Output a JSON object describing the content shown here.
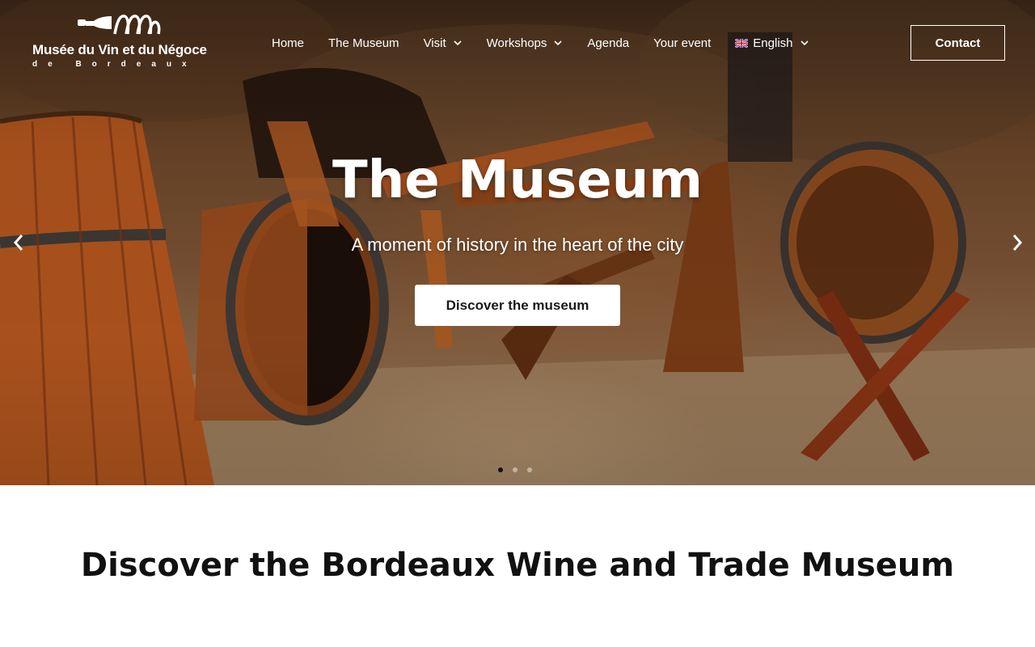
{
  "logo": {
    "line1": "Musée du Vin et du Négoce",
    "line2": "de Bordeaux"
  },
  "nav": {
    "items": [
      {
        "label": "Home",
        "dropdown": false
      },
      {
        "label": "The Museum",
        "dropdown": false
      },
      {
        "label": "Visit",
        "dropdown": true
      },
      {
        "label": "Workshops",
        "dropdown": true
      },
      {
        "label": "Agenda",
        "dropdown": false
      },
      {
        "label": "Your event",
        "dropdown": false
      }
    ],
    "language": {
      "label": "English",
      "flag": "uk-flag-icon"
    },
    "contact_label": "Contact"
  },
  "hero": {
    "title": "The Museum",
    "subtitle": "A moment of history in the heart of the city",
    "cta_label": "Discover the museum",
    "slides_total": 3,
    "active_slide": 1
  },
  "main": {
    "heading": "Discover the Bordeaux Wine and Trade Museum"
  },
  "colors": {
    "text_dark": "#111111",
    "white": "#ffffff",
    "hero_tone": "#7a5234"
  }
}
